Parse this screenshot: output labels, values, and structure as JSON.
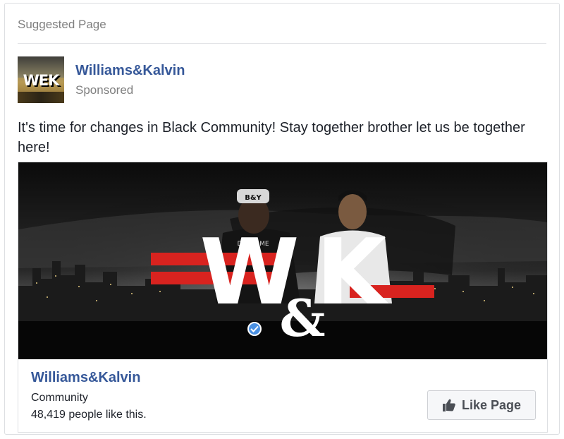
{
  "header": {
    "label": "Suggested Page"
  },
  "post": {
    "page_name": "Williams&Kalvin",
    "sponsored_label": "Sponsored",
    "avatar_logo_text": "WEK",
    "text": "It's time for changes in Black Community! Stay together brother let us be together here!"
  },
  "cover": {
    "logo_left": "W",
    "logo_amp": "&",
    "logo_right": "K",
    "cap_text": "B&Y",
    "shirt_text": "DON'T ME"
  },
  "link_card": {
    "title": "Williams&Kalvin",
    "category": "Community",
    "likes": "48,419 people like this.",
    "like_button_label": "Like Page"
  },
  "colors": {
    "link_blue": "#365899",
    "meta_gray": "#7f7f7f",
    "accent_red": "#d8231f",
    "verified_blue": "#4a90e2"
  },
  "icons": {
    "like_button": "thumbs-up-icon",
    "verified": "verified-check-icon"
  }
}
